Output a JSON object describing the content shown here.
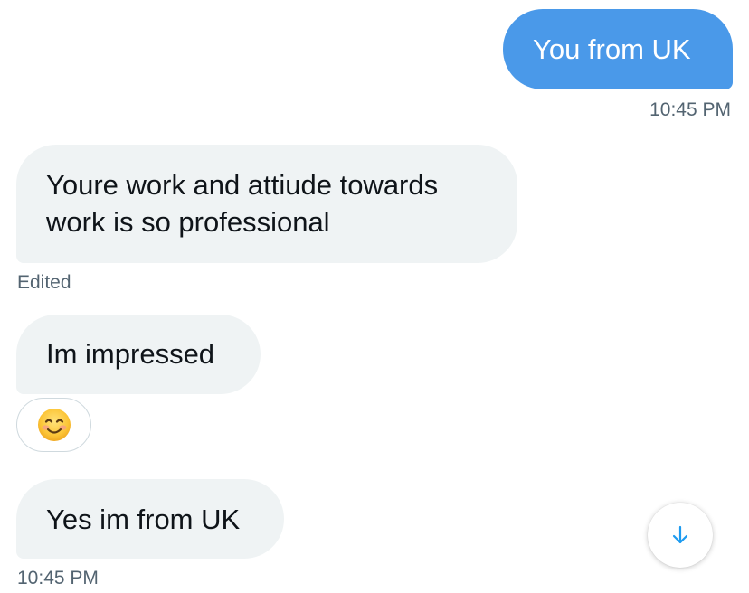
{
  "messages": [
    {
      "direction": "outgoing",
      "text": "You from UK",
      "timestamp": "10:45 PM"
    },
    {
      "direction": "incoming",
      "lines": [
        "Youre work and attiude towards",
        "work is so professional"
      ],
      "edited_label": "Edited"
    },
    {
      "direction": "incoming",
      "text": "Im impressed",
      "reaction": "smiling-face-emoji"
    },
    {
      "direction": "incoming",
      "text": "Yes im from UK",
      "timestamp": "10:45 PM"
    }
  ],
  "scroll_button": {
    "icon": "arrow-down-icon"
  },
  "colors": {
    "outgoing_bubble": "#4a99e9",
    "incoming_bubble": "#eff3f4",
    "accent": "#1d9bf0",
    "meta_text": "#536471"
  }
}
